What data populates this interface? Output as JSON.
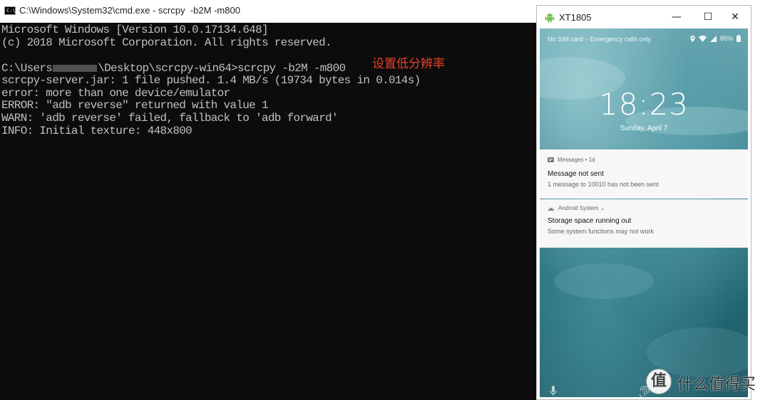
{
  "cmd": {
    "title": "C:\\Windows\\System32\\cmd.exe - scrcpy  -b2M -m800",
    "icon_text": "C:\\.",
    "lines": [
      "Microsoft Windows [Version 10.0.17134.648]",
      "(c) 2018 Microsoft Corporation. All rights reserved.",
      "",
      "\\Desktop\\scrcpy-win64>scrcpy -b2M -m800",
      "scrcpy-server.jar: 1 file pushed. 1.4 MB/s (19734 bytes in 0.014s)",
      "error: more than one device/emulator",
      "ERROR: \"adb reverse\" returned with value 1",
      "WARN: 'adb reverse' failed, fallback to 'adb forward'",
      "INFO: Initial texture: 448x800"
    ],
    "prompt_prefix": "C:\\Users",
    "annotation": "设置低分辨率"
  },
  "phone": {
    "window_title": "XT1805",
    "controls": {
      "minimize": "—",
      "maximize": "☐",
      "close": "✕"
    },
    "status_text": "No SIM card – Emergency calls only",
    "battery": "85%",
    "time": "18:23",
    "date": "Sunday, April 7",
    "notifications": [
      {
        "app": "Messages • 1d",
        "title": "Message not sent",
        "body": "1 message to 10010 has not been sent"
      },
      {
        "app": "Android System ⌄",
        "title": "Storage space running out",
        "body": "Some system functions may not work"
      }
    ]
  },
  "watermark": {
    "logo": "值",
    "text": "什么值得买"
  },
  "colors": {
    "console_bg": "#0c0c0c",
    "console_text": "#c0c0c0",
    "annotation": "#e8412c",
    "android_green": "#78c257"
  }
}
